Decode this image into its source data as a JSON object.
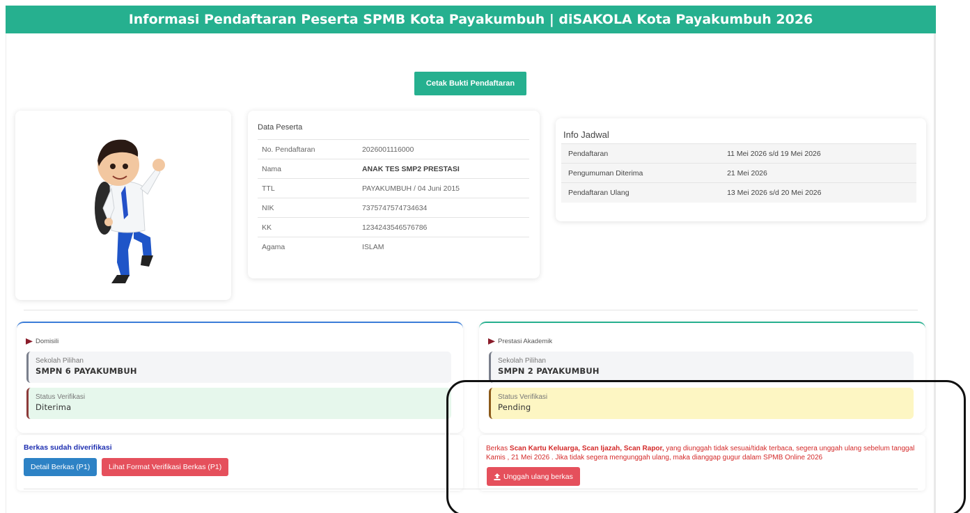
{
  "header": {
    "title": "Informasi Pendaftaran Peserta SPMB Kota Payakumbuh | diSAKOLA Kota Payakumbuh 2026"
  },
  "actions": {
    "print_label": "Cetak Bukti Pendaftaran"
  },
  "peserta": {
    "title": "Data Peserta",
    "rows": [
      {
        "label": "No. Pendaftaran",
        "value": "2026001116000"
      },
      {
        "label": "Nama",
        "value": "ANAK TES SMP2 PRESTASI"
      },
      {
        "label": "TTL",
        "value": "PAYAKUMBUH / 04 Juni 2015"
      },
      {
        "label": "NIK",
        "value": "7375747574734634"
      },
      {
        "label": "KK",
        "value": "1234243546576786"
      },
      {
        "label": "Agama",
        "value": "ISLAM"
      }
    ]
  },
  "jadwal": {
    "title": "Info Jadwal",
    "rows": [
      {
        "label": "Pendaftaran",
        "value": "11 Mei 2026 s/d 19 Mei 2026"
      },
      {
        "label": "Pengumuman Diterima",
        "value": "21 Mei 2026"
      },
      {
        "label": "Pendaftaran Ulang",
        "value": "13 Mei 2026 s/d 20 Mei 2026"
      }
    ]
  },
  "choices": [
    {
      "type": "Domisili",
      "school_label": "Sekolah Pilihan",
      "school": "SMPN 6 PAYAKUMBUH",
      "status_label": "Status Verifikasi",
      "status": "Diterima"
    },
    {
      "type": "Prestasi Akademik",
      "school_label": "Sekolah Pilihan",
      "school": "SMPN 2 PAYAKUMBUH",
      "status_label": "Status Verifikasi",
      "status": "Pending"
    }
  ],
  "berkas_left": {
    "verified_text": "Berkas sudah diverifikasi",
    "detail_label": "Detail Berkas (P1)",
    "format_label": "Lihat Format Verifikasi Berkas (P1)"
  },
  "berkas_right": {
    "warn_prefix": "Berkas ",
    "warn_files": "Scan Kartu Keluarga, Scan Ijazah, Scan Rapor,",
    "warn_suffix": " yang diunggah tidak sesuai/tidak terbaca, segera unggah ulang sebelum tanggal Kamis , 21 Mei 2026 . Jika tidak segera mengunggah ulang, maka dianggap gugur dalam SPMB Online 2026",
    "upload_label": "Unggah ulang berkas"
  },
  "colors": {
    "accent": "#26b08f",
    "primary": "#2d82c5",
    "danger": "#e5505c",
    "success_bg": "#e6f7ec",
    "warning_bg": "#fdf6c3",
    "warning_text": "#d42a2a"
  },
  "icons": {
    "flag": "flag-icon",
    "upload": "upload-icon",
    "avatar": "student-illustration"
  }
}
